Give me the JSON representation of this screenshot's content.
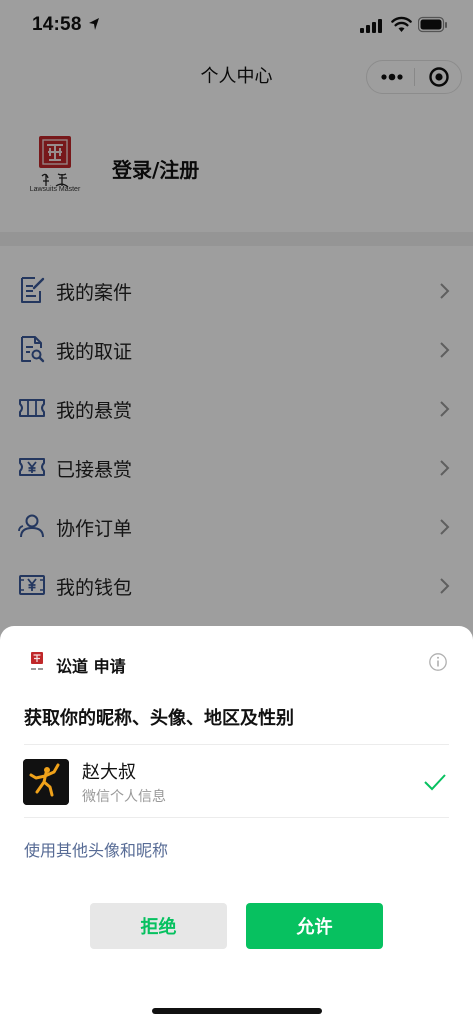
{
  "status_bar": {
    "time": "14:58"
  },
  "nav": {
    "title": "个人中心"
  },
  "profile": {
    "logo_caption": "Lawsuits Master",
    "login_label": "登录/注册"
  },
  "menu": {
    "items": [
      {
        "label": "我的案件",
        "icon": "document-edit-icon"
      },
      {
        "label": "我的取证",
        "icon": "document-search-icon"
      },
      {
        "label": "我的悬赏",
        "icon": "ticket-icon"
      },
      {
        "label": "已接悬赏",
        "icon": "yen-ticket-icon"
      },
      {
        "label": "协作订单",
        "icon": "users-icon"
      },
      {
        "label": "我的钱包",
        "icon": "wallet-icon"
      }
    ]
  },
  "sheet": {
    "app_name": "讼道 申请",
    "heading": "获取你的昵称、头像、地区及性别",
    "account_name": "赵大叔",
    "account_sub": "微信个人信息",
    "other_link": "使用其他头像和昵称",
    "reject_label": "拒绝",
    "allow_label": "允许"
  },
  "colors": {
    "accent_green": "#07c160",
    "link_blue": "#576b95",
    "icon_blue": "#3a5a9a"
  }
}
